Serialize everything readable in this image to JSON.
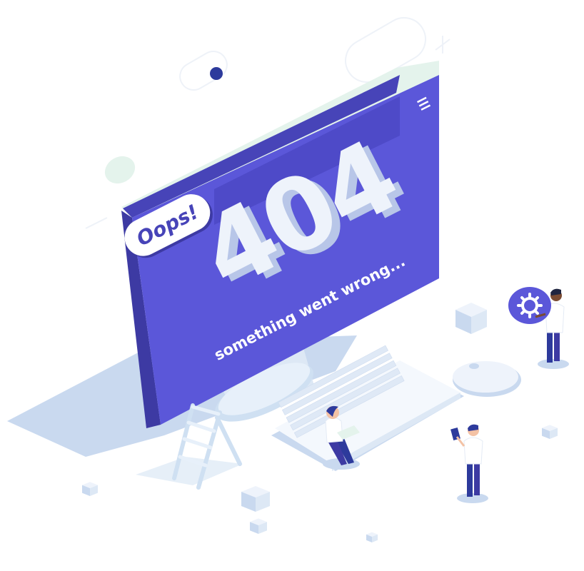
{
  "screen": {
    "badge_text": "Oops!",
    "code_text": "404",
    "message_text": "something went wrong..."
  },
  "colors": {
    "screen": "#5b57d9",
    "screen_side": "#4744b8",
    "screen_shadow": "#3d3aa3",
    "light_mint": "#e4f3ec",
    "ice": "#dde8f5",
    "cube": "#d6e4f3",
    "shadow": "#c9d9ef",
    "navy": "#2d3a9c"
  },
  "icons": [
    "menu-icon",
    "gear-icon"
  ]
}
